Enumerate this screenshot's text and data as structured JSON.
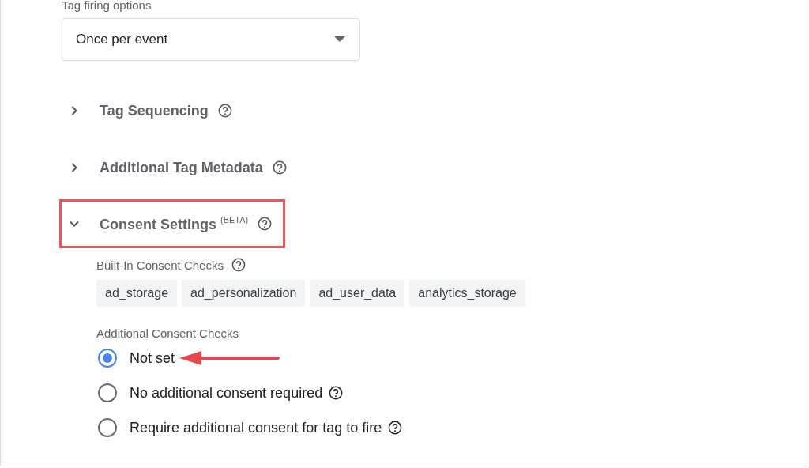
{
  "firing": {
    "label": "Tag firing options",
    "value": "Once per event"
  },
  "sections": [
    {
      "title": "Tag Sequencing",
      "expanded": false,
      "highlighted": false
    },
    {
      "title": "Additional Tag Metadata",
      "expanded": false,
      "highlighted": false
    },
    {
      "title": "Consent Settings $^{(BETA)}$",
      "expanded": true,
      "highlighted": true
    }
  ],
  "consent": {
    "builtin_label": "Built-In Consent Checks",
    "chips": [
      "ad_storage",
      "ad_personalization",
      "ad_user_data",
      "analytics_storage"
    ],
    "additional_label": "Additional Consent Checks",
    "options": [
      {
        "label": "Not set",
        "selected": true,
        "help": false,
        "arrow": true
      },
      {
        "label": "No additional consent required",
        "selected": false,
        "help": true,
        "arrow": false
      },
      {
        "label": "Require additional consent for tag to fire",
        "selected": false,
        "help": true,
        "arrow": false
      }
    ]
  }
}
